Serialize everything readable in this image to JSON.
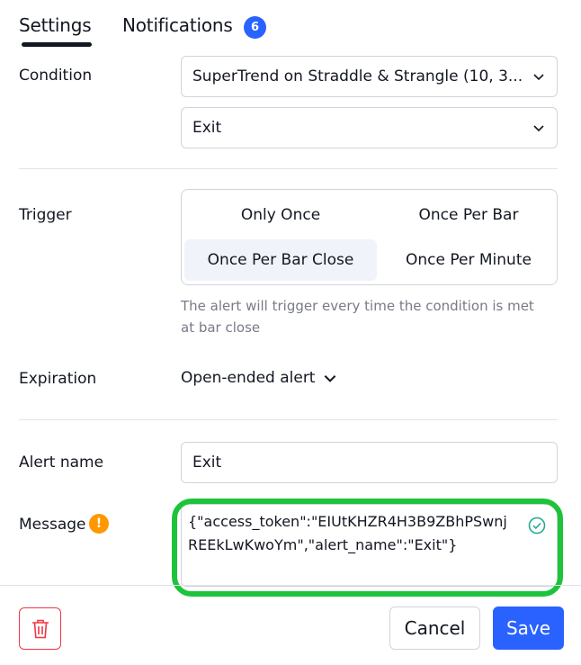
{
  "tabs": {
    "settings_label": "Settings",
    "notifications_label": "Notifications",
    "notifications_count": "6"
  },
  "condition": {
    "label": "Condition",
    "primary_value": "SuperTrend on Straddle & Strangle (10, 3...",
    "secondary_value": "Exit"
  },
  "trigger": {
    "label": "Trigger",
    "options": [
      "Only Once",
      "Once Per Bar",
      "Once Per Bar Close",
      "Once Per Minute"
    ],
    "selected": "Once Per Bar Close",
    "hint": "The alert will trigger every time the condition is met at bar close"
  },
  "expiration": {
    "label": "Expiration",
    "value": "Open-ended alert"
  },
  "alert_name": {
    "label": "Alert name",
    "value": "Exit"
  },
  "message": {
    "label": "Message",
    "value": "{\"access_token\":\"EIUtKHZR4H3B9ZBhPSwnjREEkLwKwoYm\",\"alert_name\":\"Exit\"}"
  },
  "footer": {
    "cancel_label": "Cancel",
    "save_label": "Save"
  },
  "colors": {
    "accent": "#2962ff",
    "warning": "#ff9800",
    "danger": "#f23645",
    "highlight": "#1ec33c"
  },
  "icons": {
    "chevron": "chevron-down-icon",
    "warning": "warning-icon",
    "valid": "check-circle-icon",
    "delete": "trash-icon"
  }
}
